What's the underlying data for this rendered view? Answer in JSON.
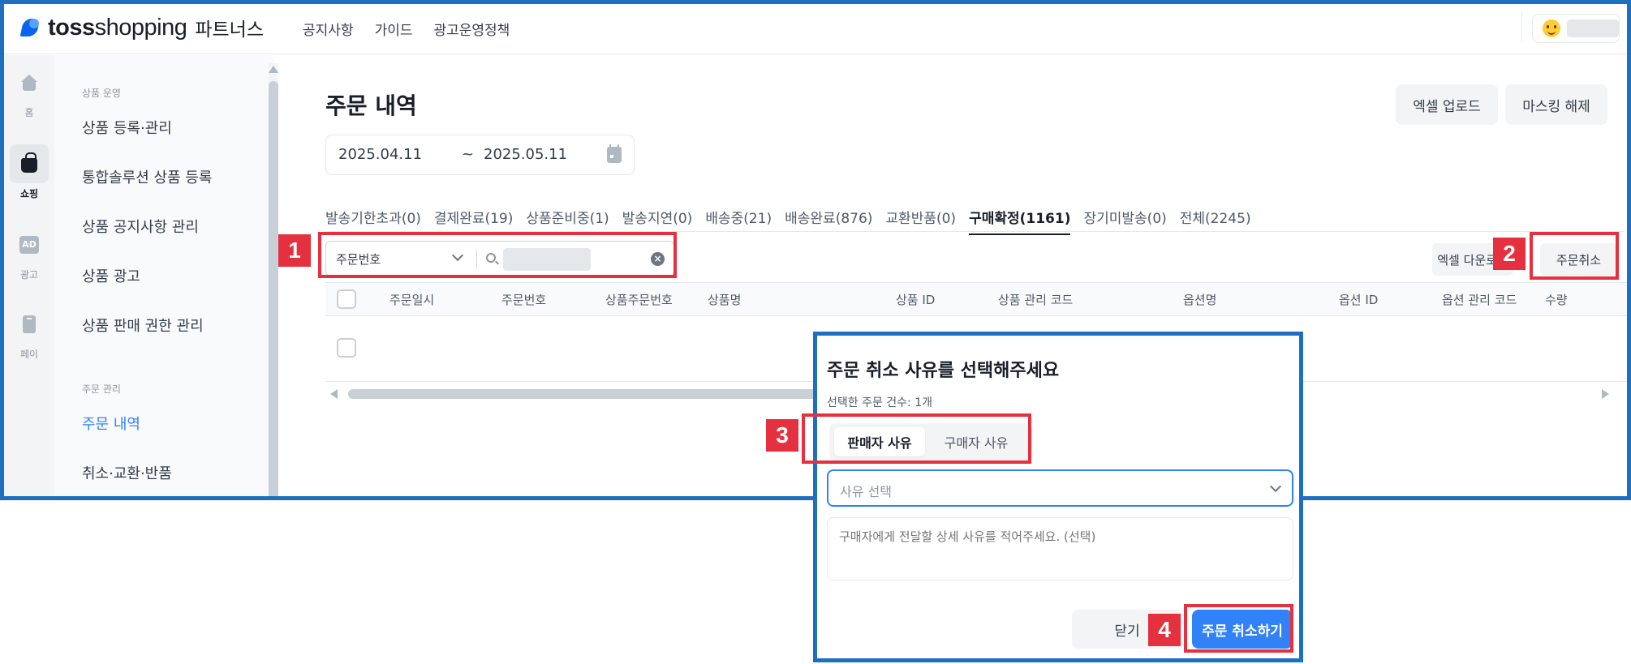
{
  "header": {
    "logo_bold": "toss",
    "logo_light": "shopping",
    "logo_suffix": "파트너스",
    "nav": [
      "공지사항",
      "가이드",
      "광고운영정책"
    ]
  },
  "rail": {
    "items": [
      {
        "label": "홈",
        "icon": "home-icon"
      },
      {
        "label": "쇼핑",
        "icon": "shopping-bag-icon"
      },
      {
        "label": "광고",
        "icon": "ad-icon"
      },
      {
        "label": "페이",
        "icon": "pay-icon"
      }
    ]
  },
  "sidebar": {
    "section1": "상품 운영",
    "items1": [
      "상품 등록·관리",
      "통합솔루션 상품 등록",
      "상품 공지사항 관리",
      "상품 광고",
      "상품 판매 권한 관리"
    ],
    "section2": "주문 관리",
    "items2": [
      "주문 내역",
      "취소·교환·반품"
    ]
  },
  "page": {
    "title": "주문 내역",
    "excel_upload": "엑셀 업로드",
    "unmask": "마스킹 해제",
    "date_from": "2025.04.11",
    "date_sep": "~",
    "date_to": "2025.05.11"
  },
  "tabs": [
    "발송기한초과(0)",
    "결제완료(19)",
    "상품준비중(1)",
    "발송지연(0)",
    "배송중(21)",
    "배송완료(876)",
    "교환반품(0)",
    "구매확정(1161)",
    "장기미발송(0)",
    "전체(2245)"
  ],
  "search": {
    "field": "주문번호"
  },
  "actions": {
    "excel_download": "엑셀 다운로드",
    "cancel_order": "주문취소"
  },
  "table": {
    "columns": [
      "주문일시",
      "주문번호",
      "상품주문번호",
      "상품명",
      "상품 ID",
      "상품 관리 코드",
      "옵션명",
      "옵션 ID",
      "옵션 관리 코드",
      "수량"
    ]
  },
  "modal": {
    "title": "주문 취소 사유를 선택해주세요",
    "subtitle": "선택한 주문 건수: 1개",
    "seg_seller": "판매자 사유",
    "seg_buyer": "구매자 사유",
    "reason_placeholder": "사유 선택",
    "detail_placeholder": "구매자에게 전달할 상세 사유를 적어주세요. (선택)",
    "close": "닫기",
    "confirm": "주문 취소하기"
  },
  "steps": [
    "1",
    "2",
    "3",
    "4"
  ],
  "colors": {
    "accent": "#3182f6",
    "highlight": "#e5303f",
    "frame": "#1f6fc0"
  }
}
